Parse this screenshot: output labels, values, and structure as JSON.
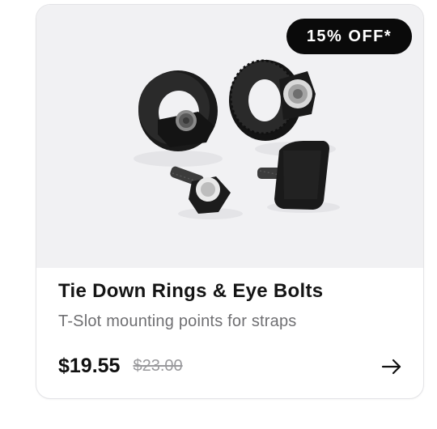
{
  "badge": {
    "label": "15% OFF*"
  },
  "product": {
    "title": "Tie Down Rings & Eye Bolts",
    "subtitle": "T-Slot mounting points for straps",
    "price": "$19.55",
    "original_price": "$23.00",
    "image_icon": "tie-down-rings-product-photo"
  },
  "actions": {
    "open_icon": "arrow-right-icon"
  },
  "colors": {
    "badge_bg": "#0a0a0a",
    "media_bg": "#f1f1f3",
    "price": "#111111",
    "muted_text": "#6f6f72"
  }
}
